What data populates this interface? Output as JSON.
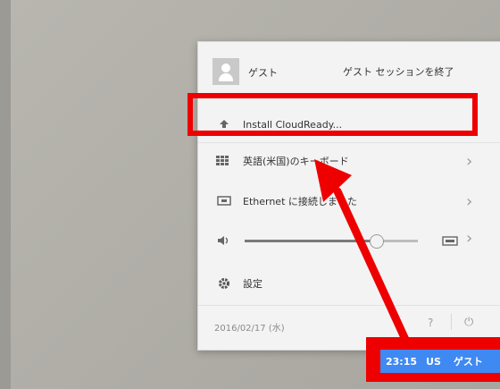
{
  "user": {
    "name": "ゲスト",
    "end_session": "ゲスト セッションを終了"
  },
  "menu": {
    "install": "Install CloudReady...",
    "keyboard": "英語(米国)のキーボード",
    "network": "Ethernet に接続しました",
    "settings": "設定"
  },
  "volume": {
    "level_percent": 76
  },
  "footer": {
    "date": "2016/02/17 (水)",
    "help": "?"
  },
  "status": {
    "time": "23:15",
    "layout": "US",
    "user": "ゲスト"
  },
  "colors": {
    "annotation_red": "#ee0000",
    "tray_blue": "#3f89f2"
  }
}
